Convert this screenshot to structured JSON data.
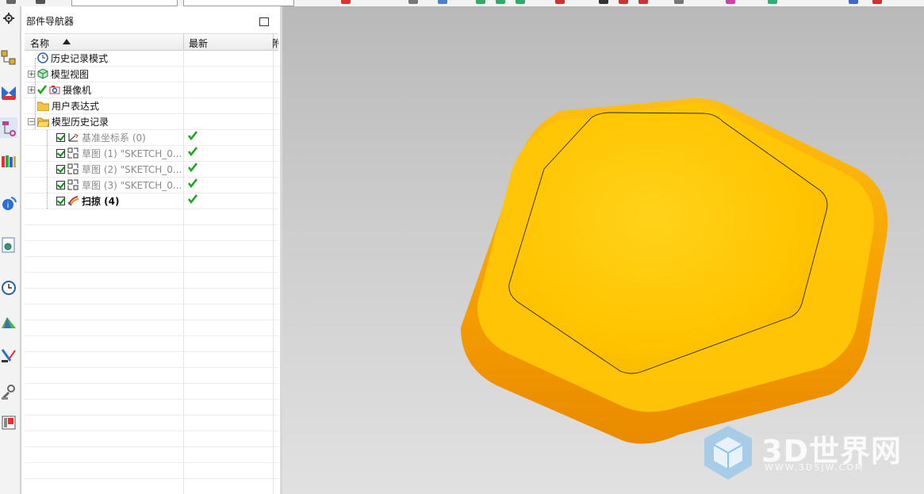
{
  "navigator": {
    "title": "部件导航器",
    "columns": [
      "名称",
      "最新",
      "附"
    ],
    "rows": [
      {
        "label": "历史记录模式",
        "style": "normal"
      },
      {
        "label": "模型视图",
        "style": "normal"
      },
      {
        "label": "摄像机",
        "style": "normal"
      },
      {
        "label": "用户表达式",
        "style": "normal"
      },
      {
        "label": "模型历史记录",
        "style": "normal"
      },
      {
        "label": "基准坐标系 (0)",
        "style": "grey"
      },
      {
        "label": "草图 (1) \"SKETCH_0...",
        "style": "grey"
      },
      {
        "label": "草图 (2) \"SKETCH_0...",
        "style": "grey"
      },
      {
        "label": "草图 (3) \"SKETCH_0...",
        "style": "grey"
      },
      {
        "label": "扫掠 (4)",
        "style": "bold"
      }
    ]
  },
  "watermark": {
    "brand": "3D世界网",
    "url": "WWW.3DSJW.COM"
  },
  "colors": {
    "part_fill": "#ffc400",
    "part_edge": "#e98a00",
    "viewport_bg": "#cdcdcd",
    "check_green": "#1aa51a"
  },
  "icons": {
    "left_toolbar": [
      "assembly-navigator-icon",
      "constraint-navigator-icon",
      "part-navigator-icon",
      "reuse-library-icon",
      "hd3d-tools-icon",
      "web-browser-icon",
      "history-icon",
      "system-materials-icon",
      "process-studio-icon",
      "manufacturing-wizard-icon",
      "roles-icon"
    ]
  }
}
